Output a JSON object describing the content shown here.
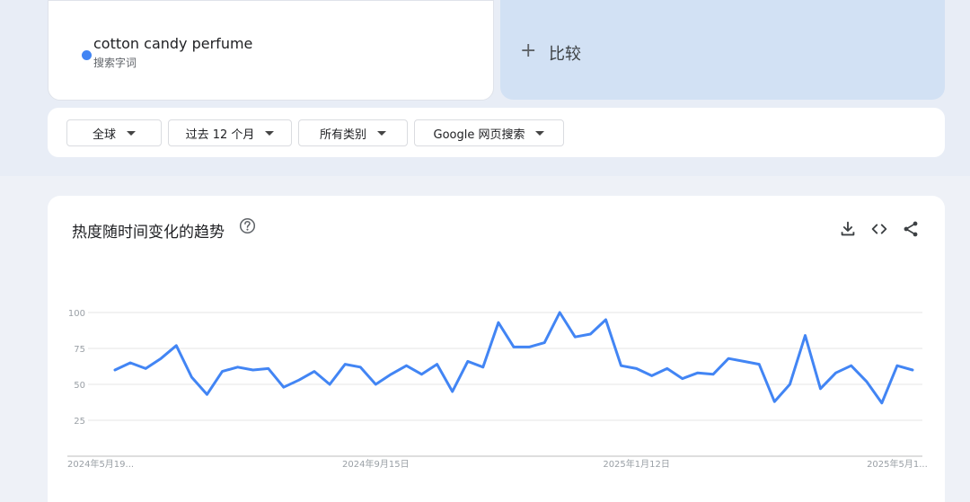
{
  "search_term": {
    "name": "cotton candy perfume",
    "type": "搜索字词",
    "color": "#4285f4"
  },
  "compare": {
    "plus": "+",
    "label": "比较"
  },
  "filters": [
    {
      "label": "全球"
    },
    {
      "label": "过去 12 个月"
    },
    {
      "label": "所有类别"
    },
    {
      "label": "Google 网页搜索"
    }
  ],
  "chart_section": {
    "title": "热度随时间变化的趋势",
    "icons": [
      "help-icon",
      "download-icon",
      "embed-icon",
      "share-icon"
    ]
  },
  "chart_data": {
    "type": "line",
    "title": "",
    "xlabel": "",
    "ylabel": "",
    "ylim": [
      0,
      100
    ],
    "y_ticks": [
      25,
      50,
      75,
      100
    ],
    "x_tick_labels": [
      "2024年5月19...",
      "2024年9月15日",
      "2025年1月12日",
      "2025年5月1..."
    ],
    "x_tick_indices": [
      0,
      17,
      34,
      51
    ],
    "grid": true,
    "series": [
      {
        "color": "#4285f4",
        "values": [
          60,
          65,
          61,
          68,
          77,
          55,
          43,
          59,
          62,
          60,
          61,
          48,
          53,
          59,
          50,
          64,
          62,
          50,
          57,
          63,
          57,
          64,
          45,
          66,
          62,
          93,
          76,
          76,
          79,
          100,
          83,
          85,
          95,
          63,
          61,
          56,
          61,
          54,
          58,
          57,
          68,
          66,
          64,
          38,
          50,
          84,
          47,
          58,
          63,
          52,
          37,
          63,
          60
        ]
      }
    ]
  }
}
